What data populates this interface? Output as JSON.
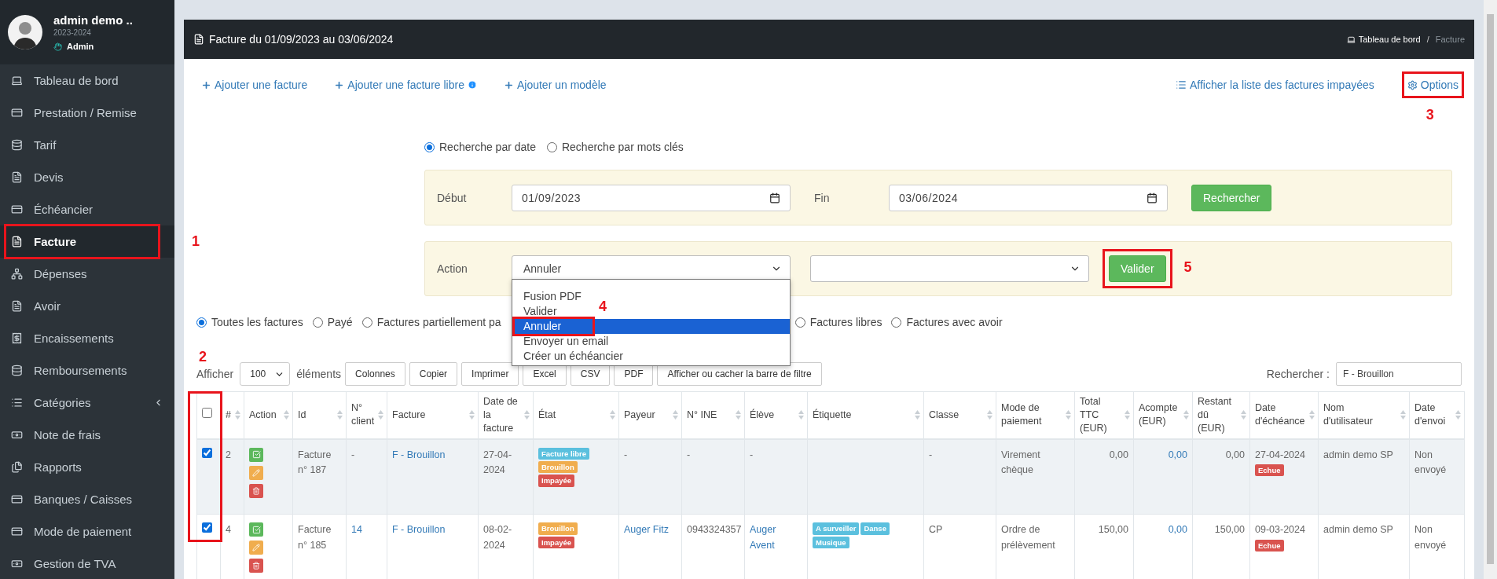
{
  "sidebar": {
    "user": {
      "name": "admin demo ..",
      "year": "2023-2024",
      "role": "Admin"
    },
    "items": [
      {
        "label": "Tableau de bord",
        "selected": false
      },
      {
        "label": "Prestation / Remise",
        "selected": false
      },
      {
        "label": "Tarif",
        "selected": false
      },
      {
        "label": "Devis",
        "selected": false
      },
      {
        "label": "Échéancier",
        "selected": false
      },
      {
        "label": "Facture",
        "selected": true,
        "callout": "1"
      },
      {
        "label": "Dépenses",
        "selected": false
      },
      {
        "label": "Avoir",
        "selected": false
      },
      {
        "label": "Encaissements",
        "selected": false
      },
      {
        "label": "Remboursements",
        "selected": false
      },
      {
        "label": "Catégories",
        "selected": false,
        "expandable": true
      },
      {
        "label": "Note de frais",
        "selected": false
      },
      {
        "label": "Rapports",
        "selected": false
      },
      {
        "label": "Banques / Caisses",
        "selected": false
      },
      {
        "label": "Mode de paiement",
        "selected": false
      },
      {
        "label": "Gestion de TVA",
        "selected": false
      }
    ]
  },
  "page": {
    "title": "Facture du 01/09/2023 au 03/06/2024",
    "breadcrumb_separator": "/",
    "breadcrumb": [
      {
        "label": "Tableau de bord",
        "selected": false
      },
      {
        "label": "Facture",
        "selected": true
      }
    ]
  },
  "actions_left": [
    {
      "label": "Ajouter une facture",
      "info": false
    },
    {
      "label": "Ajouter une facture libre",
      "info": true
    },
    {
      "label": "Ajouter un modèle",
      "info": false
    }
  ],
  "actions_right": [
    {
      "label": "Afficher la liste des factures impayées",
      "kind": "list"
    },
    {
      "label": "Options",
      "kind": "settings",
      "callout": "3"
    }
  ],
  "search_mode": [
    {
      "label": "Recherche par date",
      "selected": true
    },
    {
      "label": "Recherche par mots clés",
      "selected": false
    }
  ],
  "date_filter": {
    "start_label": "Début",
    "start": "01/09/2023",
    "end_label": "Fin",
    "end": "03/06/2024",
    "button": "Rechercher"
  },
  "action_bar": {
    "label": "Action",
    "value": "Annuler",
    "button": "Valider",
    "button_callout": "5",
    "menu": [
      {
        "label": "Fusion PDF",
        "selected": false
      },
      {
        "label": "Valider",
        "selected": false
      },
      {
        "label": "Annuler",
        "selected": true,
        "callout": "4"
      },
      {
        "label": "Envoyer un email",
        "selected": false
      },
      {
        "label": "Créer un échéancier",
        "selected": false
      }
    ]
  },
  "status_filter": [
    {
      "label": "Toutes les factures",
      "selected": true
    },
    {
      "label": "Payé",
      "selected": false
    },
    {
      "label": "Factures partiellement pa",
      "selected": false
    },
    {
      "label": "Factures libres",
      "selected": false
    },
    {
      "label": "Factures avec avoir",
      "selected": false
    }
  ],
  "toolbar": {
    "show_label": "Afficher",
    "page_size": "100",
    "entries_label": "éléments",
    "buttons": [
      "Colonnes",
      "Copier",
      "Imprimer",
      "Excel",
      "CSV",
      "PDF",
      "Afficher ou cacher la barre de filtre"
    ],
    "search_label": "Rechercher :",
    "search_value": "F - Brouillon"
  },
  "table": {
    "callout": "2",
    "header_checked": false,
    "columns": [
      {
        "kind": "check"
      },
      {
        "label": "#",
        "kind": "text"
      },
      {
        "label": "Action",
        "kind": "actions"
      },
      {
        "label": "Id",
        "kind": "text"
      },
      {
        "label": "N° client",
        "kind": "link"
      },
      {
        "label": "Facture",
        "kind": "link"
      },
      {
        "label": "Date de la facture",
        "kind": "text"
      },
      {
        "label": "État",
        "kind": "badges"
      },
      {
        "label": "Payeur",
        "kind": "link"
      },
      {
        "label": "N° INE",
        "kind": "text"
      },
      {
        "label": "Élève",
        "kind": "link"
      },
      {
        "label": "Étiquette",
        "kind": "badges"
      },
      {
        "label": "Classe",
        "kind": "text"
      },
      {
        "label": "Mode de paiement",
        "kind": "text"
      },
      {
        "label": "Total TTC (EUR)",
        "kind": "number"
      },
      {
        "label": "Acompte (EUR)",
        "kind": "number_link"
      },
      {
        "label": "Restant dû (EUR)",
        "kind": "number"
      },
      {
        "label": "Date d'échéance",
        "kind": "due"
      },
      {
        "label": "Nom d'utilisateur",
        "kind": "text"
      },
      {
        "label": "Date d'envoi",
        "kind": "text"
      }
    ],
    "rows": [
      {
        "checked": true,
        "cells": [
          "",
          "2",
          "",
          "Facture n° 187",
          "-",
          "F - Brouillon",
          "27-04-2024",
          [
            {
              "label": "Facture libre",
              "color": "#5bc0de"
            },
            {
              "label": "Brouillon",
              "color": "#f0ad4e"
            },
            {
              "label": "Impayée",
              "color": "#d9534f"
            }
          ],
          "-",
          "-",
          "-",
          [],
          "-",
          "Virement chèque",
          "0,00",
          "0,00",
          "0,00",
          {
            "date": "27-04-2024",
            "badge": "Echue",
            "color": "#d9534f"
          },
          "admin demo SP",
          "Non envoyé"
        ]
      },
      {
        "checked": true,
        "cells": [
          "",
          "4",
          "",
          "Facture n° 185",
          "14",
          "F - Brouillon",
          "08-02-2024",
          [
            {
              "label": "Brouillon",
              "color": "#f0ad4e"
            },
            {
              "label": "Impayée",
              "color": "#d9534f"
            }
          ],
          "Auger Fitz",
          "0943324357",
          "Auger Avent",
          [
            {
              "label": "A surveiller",
              "color": "#5bc0de"
            },
            {
              "label": "Danse",
              "color": "#5bc0de"
            },
            {
              "label": "Musique",
              "color": "#5bc0de"
            }
          ],
          "CP",
          "Ordre de prélèvement",
          "150,00",
          "0,00",
          "150,00",
          {
            "date": "09-03-2024",
            "badge": "Echue",
            "color": "#d9534f"
          },
          "admin demo SP",
          "Non envoyé"
        ]
      }
    ]
  }
}
